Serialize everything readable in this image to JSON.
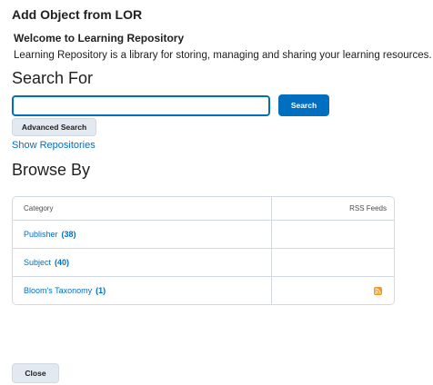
{
  "dialog": {
    "title": "Add Object from LOR"
  },
  "welcome": {
    "title": "Welcome to Learning Repository",
    "description": "Learning Repository is a library for storing, managing and sharing your learning resources."
  },
  "search": {
    "heading": "Search For",
    "input_value": "",
    "button_label": "Search",
    "advanced_label": "Advanced Search",
    "show_repositories_label": "Show Repositories"
  },
  "browse": {
    "heading": "Browse By",
    "columns": {
      "category": "Category",
      "rss": "RSS Feeds"
    },
    "rows": [
      {
        "label": "Publisher",
        "count": "(38)",
        "has_rss": false
      },
      {
        "label": "Subject",
        "count": "(40)",
        "has_rss": false
      },
      {
        "label": "Bloom's Taxonomy",
        "count": "(1)",
        "has_rss": true,
        "rss_icon": "rss-feed-icon"
      }
    ]
  },
  "footer": {
    "close_label": "Close"
  },
  "colors": {
    "accent": "#006fbf",
    "rss": "#f29a26",
    "secondary_button": "#e3e9f1"
  }
}
